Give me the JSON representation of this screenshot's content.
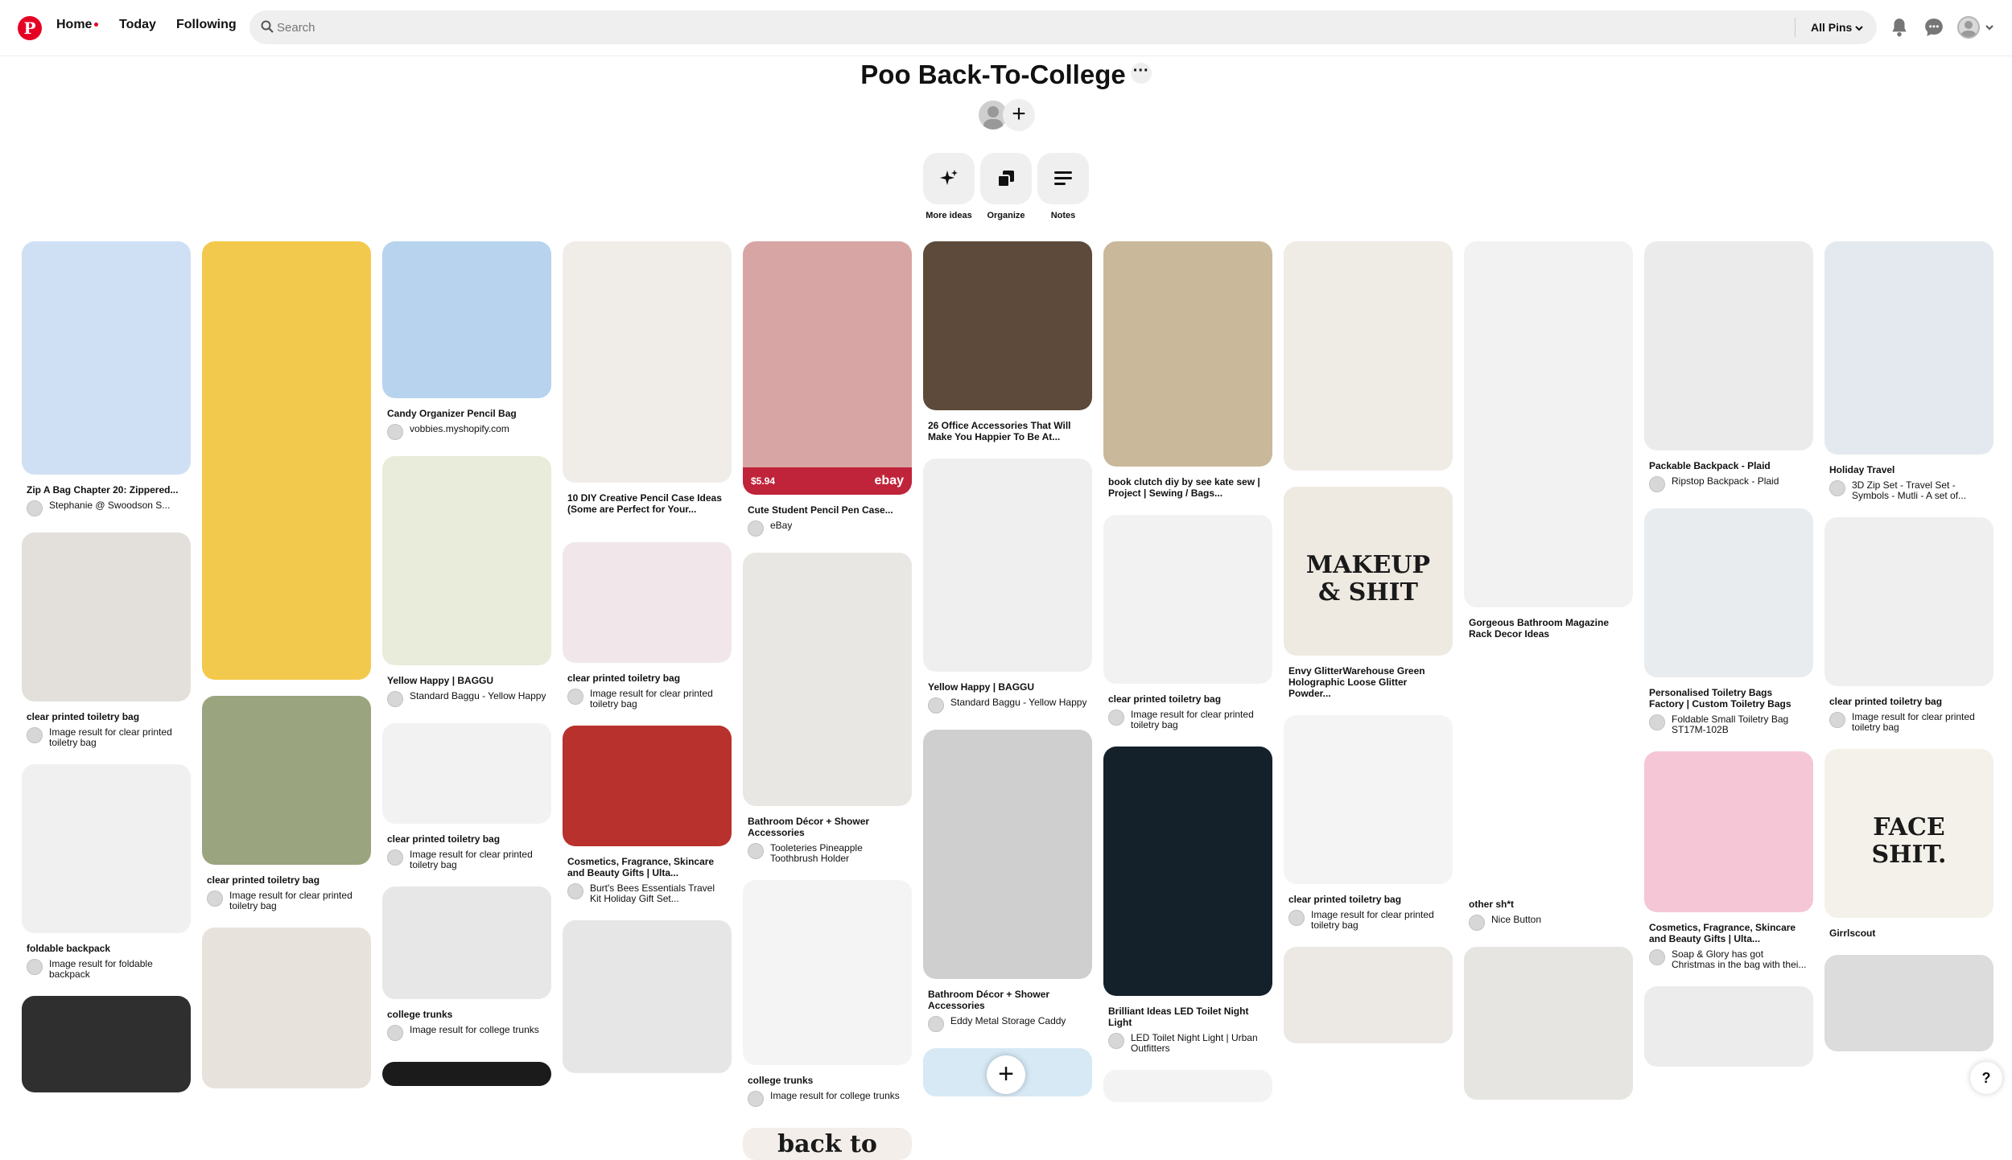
{
  "header": {
    "logo_letter": "P",
    "nav": {
      "home": "Home",
      "today": "Today",
      "following": "Following"
    },
    "search": {
      "placeholder": "Search"
    },
    "filter": "All Pins",
    "icons": [
      "bell-icon",
      "message-icon",
      "avatar",
      "chevron-down-icon"
    ]
  },
  "board": {
    "title": "Poo Back-To-College",
    "more_label": "···",
    "add_collaborator": "+",
    "tools": [
      {
        "label": "More ideas",
        "icon": "sparkle-icon"
      },
      {
        "label": "Organize",
        "icon": "organize-icon"
      },
      {
        "label": "Notes",
        "icon": "notes-icon"
      }
    ]
  },
  "pins": [
    {
      "title": "Zip A Bag Chapter 20: Zippered...",
      "source": "Stephanie @ Swoodson S...",
      "color": "#cfe0f4"
    },
    {
      "title": "clear printed toiletry bag",
      "source": "Image result for clear printed toiletry bag",
      "color": "#e3e0db"
    },
    {
      "title": "foldable backpack",
      "source": "Image result for foldable backpack",
      "color": "#f0f0f0"
    },
    {
      "title": "",
      "source": "",
      "color": "#2f2f2f"
    },
    {
      "title": "",
      "source": "",
      "color": "#f2c94c"
    },
    {
      "title": "clear printed toiletry bag",
      "source": "Image result for clear printed toiletry bag",
      "color": "#9aa57f"
    },
    {
      "title": "",
      "source": "",
      "color": "#e8e2dc"
    },
    {
      "title": "Candy Organizer Pencil Bag",
      "source": "vobbies.myshopify.com",
      "color": "#b7d3ee"
    },
    {
      "title": "Yellow Happy | BAGGU",
      "source": "Standard Baggu - Yellow Happy",
      "color": "#e9ecda"
    },
    {
      "title": "clear printed toiletry bag",
      "source": "Image result for clear printed toiletry bag",
      "color": "#f2f2f2"
    },
    {
      "title": "college trunks",
      "source": "Image result for college trunks",
      "color": "#e7e7e7"
    },
    {
      "title": "",
      "source": "",
      "color": "#1b1b1b"
    },
    {
      "title": "10 DIY Creative Pencil Case Ideas (Some are Perfect for Your...",
      "source": "",
      "color": "#f0ede8"
    },
    {
      "title": "clear printed toiletry bag",
      "source": "Image result for clear printed toiletry bag",
      "color": "#f1e7ea"
    },
    {
      "title": "Cosmetics, Fragrance, Skincare and Beauty Gifts | Ulta...",
      "source": "Burt's Bees Essentials Travel Kit Holiday Gift Set...",
      "color": "#b8312c"
    },
    {
      "title": "",
      "source": "",
      "color": "#e6e6e6"
    },
    {
      "title": "Cute Student Pencil Pen Case...",
      "source": "eBay",
      "color": "#d8a5a5",
      "price": "$5.94",
      "store_badge": "ebay"
    },
    {
      "title": "Bathroom Décor + Shower Accessories",
      "source": "Tooleteries Pineapple Toothbrush Holder",
      "color": "#e9e7e3"
    },
    {
      "title": "college trunks",
      "source": "Image result for college trunks",
      "color": "#f4f4f4"
    },
    {
      "title": "",
      "source": "",
      "color": "#f3eee9",
      "caption": "back to school"
    },
    {
      "title": "26 Office Accessories That Will Make You Happier To Be At...",
      "source": "",
      "color": "#5d4a3a"
    },
    {
      "title": "Yellow Happy | BAGGU",
      "source": "Standard Baggu - Yellow Happy",
      "color": "#efefef"
    },
    {
      "title": "Bathroom Décor + Shower Accessories",
      "source": "Eddy Metal Storage Caddy",
      "color": "#cfcfcf"
    },
    {
      "title": "",
      "source": "",
      "color": "#d6e9f5"
    },
    {
      "title": "book clutch diy by see kate sew | Project | Sewing / Bags...",
      "source": "",
      "color": "#c9b99a"
    },
    {
      "title": "clear printed toiletry bag",
      "source": "Image result for clear printed toiletry bag",
      "color": "#f2f2f2"
    },
    {
      "title": "Brilliant Ideas LED Toilet Night Light",
      "source": "LED Toilet Night Light | Urban Outfitters",
      "color": "#14202a"
    },
    {
      "title": "",
      "source": "",
      "color": "#f3f3f3"
    },
    {
      "title": "",
      "source": "",
      "color": "#efece6"
    },
    {
      "title": "Envy GlitterWarehouse Green Holographic Loose Glitter Powder...",
      "source": "",
      "color": "#eeeae2",
      "caption": "MAKEUP & SHIT"
    },
    {
      "title": "clear printed toiletry bag",
      "source": "Image result for clear printed toiletry bag",
      "color": "#f4f4f4"
    },
    {
      "title": "",
      "source": "",
      "color": "#ece8e3"
    },
    {
      "title": "Gorgeous Bathroom Magazine Rack Decor Ideas",
      "source": "",
      "color": "#f2f2f2"
    },
    {
      "title": "other sh*t",
      "source": "Nice Button",
      "color": "#ffffff"
    },
    {
      "title": "",
      "source": "",
      "color": "#e7e5e2"
    },
    {
      "title": "Packable Backpack - Plaid",
      "source": "Ripstop Backpack - Plaid",
      "color": "#ebebeb"
    },
    {
      "title": "Personalised Toiletry Bags Factory | Custom Toiletry Bags",
      "source": "Foldable Small Toiletry Bag ST17M-102B",
      "color": "#e9ecef"
    },
    {
      "title": "Cosmetics, Fragrance, Skincare and Beauty Gifts | Ulta...",
      "source": "Soap & Glory has got Christmas in the bag with thei...",
      "color": "#f4c6d6"
    },
    {
      "title": "",
      "source": "",
      "color": "#ececec"
    },
    {
      "title": "Holiday Travel",
      "source": "3D Zip Set - Travel Set - Symbols - Mutli - A set of...",
      "color": "#e3e9ef"
    },
    {
      "title": "clear printed toiletry bag",
      "source": "Image result for clear printed toiletry bag",
      "color": "#efefef"
    },
    {
      "title": "Girrlscout",
      "source": "",
      "color": "#f4f1ea",
      "caption": "FACE SHIT."
    },
    {
      "title": "",
      "source": "",
      "color": "#dcdcdc"
    }
  ],
  "overlay": {
    "add_pin": "+",
    "help": "?"
  }
}
